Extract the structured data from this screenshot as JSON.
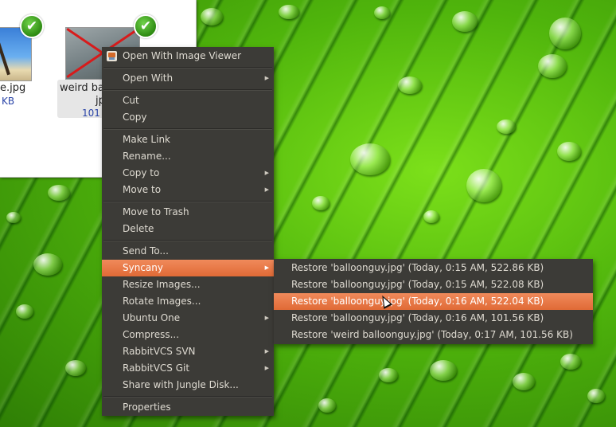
{
  "file_manager": {
    "files": [
      {
        "name": "e.jpg",
        "size": "KB"
      },
      {
        "name_line1": "weird ba",
        "name_line2": "jp",
        "size": "101"
      }
    ]
  },
  "context_menu": {
    "items": [
      {
        "label": "Open With Image Viewer",
        "icon": "image-viewer-icon"
      },
      {
        "label": "Open With",
        "submenu": true
      },
      {
        "label": "Cut"
      },
      {
        "label": "Copy"
      },
      {
        "label": "Make Link"
      },
      {
        "label": "Rename..."
      },
      {
        "label": "Copy to",
        "submenu": true
      },
      {
        "label": "Move to",
        "submenu": true
      },
      {
        "label": "Move to Trash"
      },
      {
        "label": "Delete"
      },
      {
        "label": "Send To..."
      },
      {
        "label": "Syncany",
        "submenu": true,
        "highlighted": true
      },
      {
        "label": "Resize Images..."
      },
      {
        "label": "Rotate Images..."
      },
      {
        "label": "Ubuntu One",
        "submenu": true
      },
      {
        "label": "Compress..."
      },
      {
        "label": "RabbitVCS SVN",
        "submenu": true
      },
      {
        "label": "RabbitVCS Git",
        "submenu": true
      },
      {
        "label": "Share with Jungle Disk..."
      },
      {
        "label": "Properties"
      }
    ]
  },
  "syncany_submenu": {
    "items": [
      {
        "label": "Restore 'balloonguy.jpg' (Today, 0:15 AM, 522.86 KB)"
      },
      {
        "label": "Restore 'balloonguy.jpg' (Today, 0:15 AM, 522.08 KB)"
      },
      {
        "label": "Restore 'balloonguy.jpg' (Today, 0:16 AM, 522.04 KB)",
        "highlighted": true
      },
      {
        "label": "Restore 'balloonguy.jpg' (Today, 0:16 AM, 101.56 KB)"
      },
      {
        "label": "Restore 'weird balloonguy.jpg' (Today, 0:17 AM, 101.56 KB)"
      }
    ]
  },
  "colors": {
    "menu_bg": "#3c3b37",
    "menu_text": "#dfdbd2",
    "highlight": "#e9773e",
    "sync_check": "#2e8b12"
  },
  "icons": {
    "sync_status": "check-icon",
    "submenu_indicator": "triangle-right-icon"
  }
}
